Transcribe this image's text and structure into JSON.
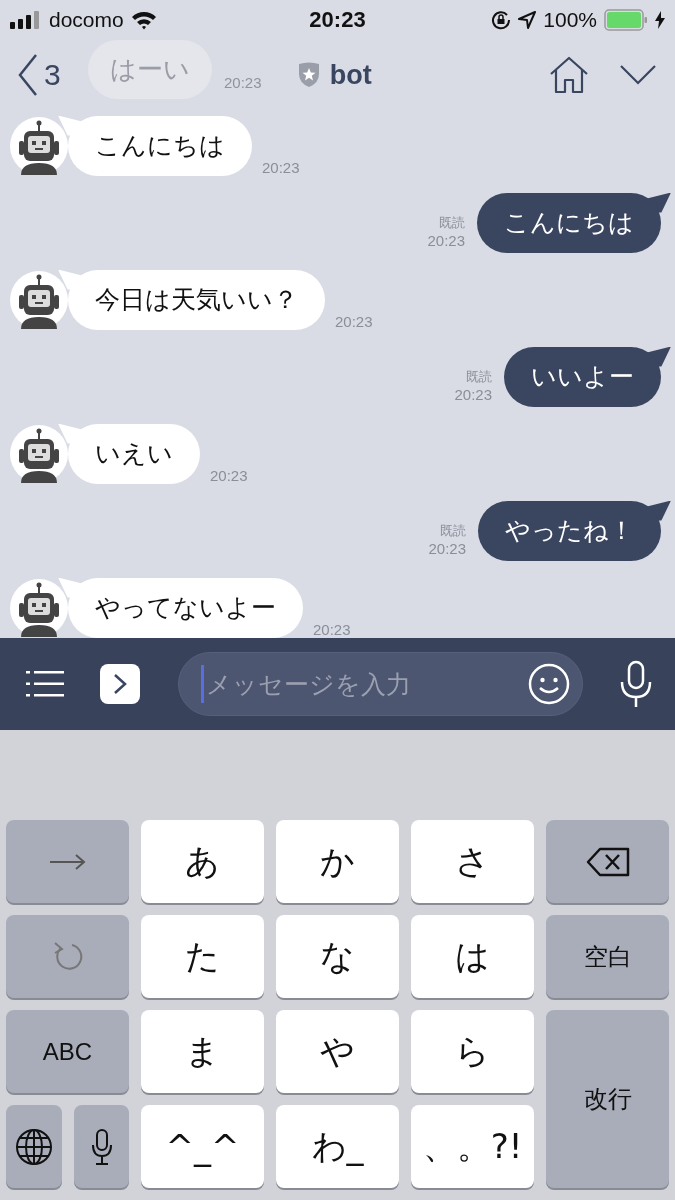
{
  "status_bar": {
    "carrier": "docomo",
    "time": "20:23",
    "battery": "100%"
  },
  "header": {
    "back_count": "3",
    "title": "bot"
  },
  "ghost_message": {
    "text": "はーい",
    "time": "20:23"
  },
  "messages": [
    {
      "kind": "incoming",
      "text": "こんにちは",
      "time": "20:23"
    },
    {
      "kind": "outgoing",
      "text": "こんにちは",
      "read": "既読",
      "time": "20:23"
    },
    {
      "kind": "incoming",
      "text": "今日は天気いい？",
      "time": "20:23"
    },
    {
      "kind": "outgoing",
      "text": "いいよー",
      "read": "既読",
      "time": "20:23"
    },
    {
      "kind": "incoming",
      "text": "いえい",
      "time": "20:23"
    },
    {
      "kind": "outgoing",
      "text": "やったね！",
      "read": "既読",
      "time": "20:23"
    },
    {
      "kind": "incoming",
      "text": "やってないよー",
      "time": "20:23"
    }
  ],
  "input": {
    "placeholder": "メッセージを入力"
  },
  "keyboard": {
    "rows": [
      [
        {
          "kind": "arrow",
          "colspan": 2
        },
        {
          "kind": "char",
          "label": "あ"
        },
        {
          "kind": "char",
          "label": "か"
        },
        {
          "kind": "char",
          "label": "さ"
        },
        {
          "kind": "backspace"
        }
      ],
      [
        {
          "kind": "undo",
          "colspan": 2
        },
        {
          "kind": "char",
          "label": "た"
        },
        {
          "kind": "char",
          "label": "な"
        },
        {
          "kind": "char",
          "label": "は"
        },
        {
          "kind": "func",
          "label": "空白"
        }
      ],
      [
        {
          "kind": "func",
          "label": "ABC",
          "colspan": 2
        },
        {
          "kind": "char",
          "label": "ま"
        },
        {
          "kind": "char",
          "label": "や"
        },
        {
          "kind": "char",
          "label": "ら"
        },
        {
          "kind": "enter",
          "label": "改行",
          "rowspan": 2
        }
      ],
      [
        {
          "kind": "globe"
        },
        {
          "kind": "mic"
        },
        {
          "kind": "char",
          "label": "^_^"
        },
        {
          "kind": "char",
          "label": "わ_"
        },
        {
          "kind": "char",
          "label": "、。?!"
        }
      ]
    ]
  }
}
